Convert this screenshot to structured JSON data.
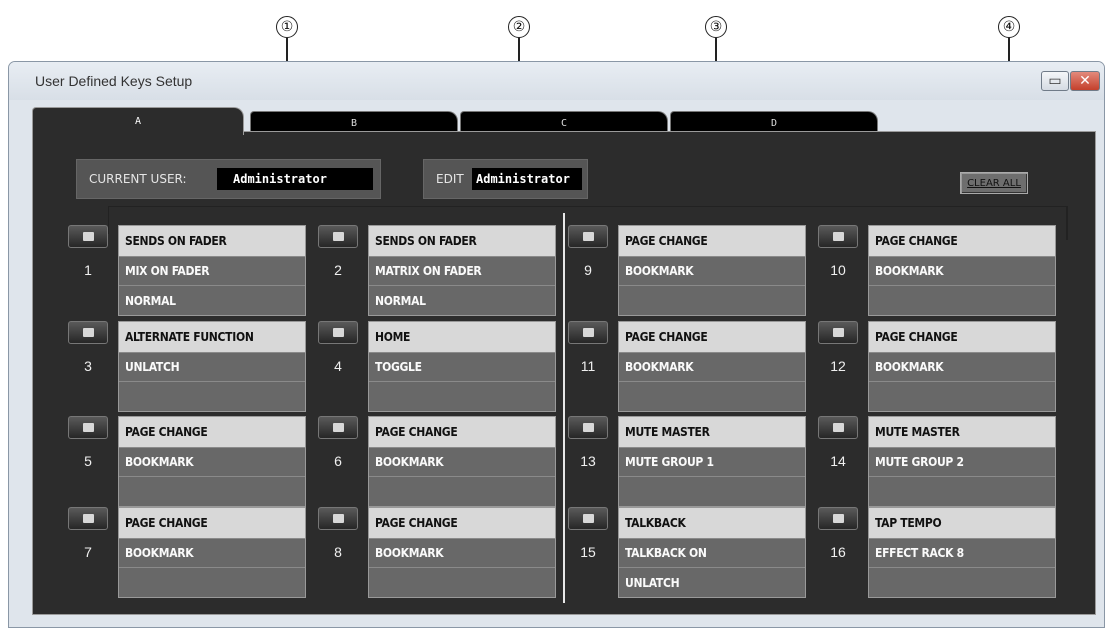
{
  "callouts": [
    "①",
    "②",
    "③",
    "④"
  ],
  "window": {
    "title": "User Defined Keys Setup",
    "minimize_glyph": "▭",
    "close_glyph": "✕"
  },
  "tabs": [
    "A",
    "B",
    "C",
    "D"
  ],
  "active_tab": "A",
  "current_user": {
    "label": "CURRENT USER:",
    "value": "Administrator"
  },
  "edit_user": {
    "label": "EDIT",
    "value": "Administrator"
  },
  "clear_all_label": "CLEAR ALL",
  "keys": [
    {
      "num": "1",
      "line1": "SENDS ON FADER",
      "line2": "MIX ON FADER",
      "line3": "NORMAL"
    },
    {
      "num": "2",
      "line1": "SENDS ON FADER",
      "line2": "MATRIX ON FADER",
      "line3": "NORMAL"
    },
    {
      "num": "9",
      "line1": "PAGE CHANGE",
      "line2": "BOOKMARK",
      "line3": ""
    },
    {
      "num": "10",
      "line1": "PAGE CHANGE",
      "line2": "BOOKMARK",
      "line3": ""
    },
    {
      "num": "3",
      "line1": "ALTERNATE FUNCTION",
      "line2": "UNLATCH",
      "line3": ""
    },
    {
      "num": "4",
      "line1": "HOME",
      "line2": "TOGGLE",
      "line3": ""
    },
    {
      "num": "11",
      "line1": "PAGE CHANGE",
      "line2": "BOOKMARK",
      "line3": ""
    },
    {
      "num": "12",
      "line1": "PAGE CHANGE",
      "line2": "BOOKMARK",
      "line3": ""
    },
    {
      "num": "5",
      "line1": "PAGE CHANGE",
      "line2": "BOOKMARK",
      "line3": ""
    },
    {
      "num": "6",
      "line1": "PAGE CHANGE",
      "line2": "BOOKMARK",
      "line3": ""
    },
    {
      "num": "13",
      "line1": "MUTE MASTER",
      "line2": "MUTE GROUP 1",
      "line3": ""
    },
    {
      "num": "14",
      "line1": "MUTE MASTER",
      "line2": "MUTE GROUP 2",
      "line3": ""
    },
    {
      "num": "7",
      "line1": "PAGE CHANGE",
      "line2": "BOOKMARK",
      "line3": ""
    },
    {
      "num": "8",
      "line1": "PAGE CHANGE",
      "line2": "BOOKMARK",
      "line3": ""
    },
    {
      "num": "15",
      "line1": "TALKBACK",
      "line2": "TALKBACK ON",
      "line3": "UNLATCH"
    },
    {
      "num": "16",
      "line1": "TAP TEMPO",
      "line2": "EFFECT RACK 8",
      "line3": ""
    }
  ]
}
